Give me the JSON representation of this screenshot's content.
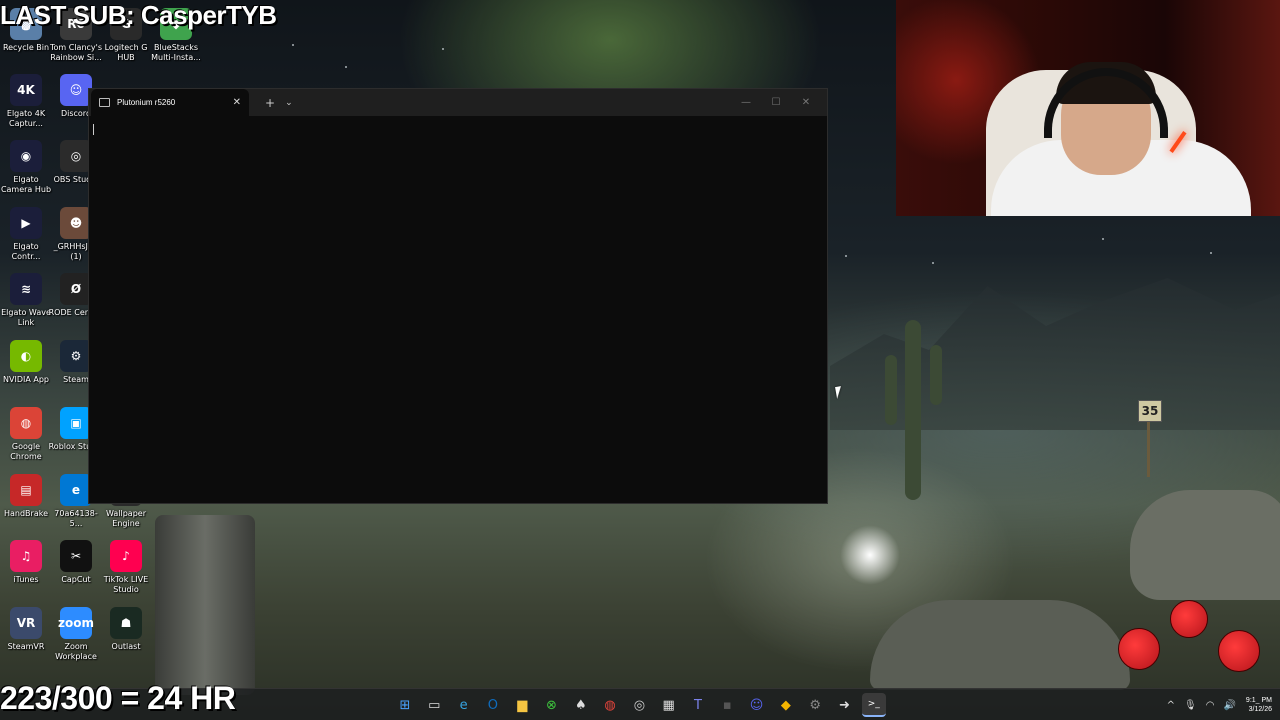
{
  "overlays": {
    "top_text": "LAST SUB: CasperTYB",
    "bottom_text": "223/300 = 24 HR"
  },
  "desktop_icons": [
    {
      "label": "Recycle Bin",
      "icon": "recycle-bin-icon",
      "color": "#5a7fa8",
      "glyph": "🗑"
    },
    {
      "label": "Tom Clancy's Rainbow Si...",
      "icon": "rainbow-six-icon",
      "color": "#3a3a3a",
      "glyph": "R6"
    },
    {
      "label": "Logitech G HUB",
      "icon": "logitech-icon",
      "color": "#2a2a2a",
      "glyph": "G"
    },
    {
      "label": "BlueStacks Multi-Insta...",
      "icon": "bluestacks-icon",
      "color": "#3fa34d",
      "glyph": "◆"
    },
    {
      "label": "Elgato 4K Captur...",
      "icon": "elgato-4k-icon",
      "color": "#1b1e3a",
      "glyph": "4K"
    },
    {
      "label": "Discord",
      "icon": "discord-icon",
      "color": "#5865f2",
      "glyph": "☺"
    },
    {
      "label": "Elgato Camera Hub",
      "icon": "elgato-camera-icon",
      "color": "#1b1e3a",
      "glyph": "◉"
    },
    {
      "label": "OBS Studio",
      "icon": "obs-icon",
      "color": "#2b2b2b",
      "glyph": "◎"
    },
    {
      "label": "Elgato Contr...",
      "icon": "elgato-control-icon",
      "color": "#1b1e3a",
      "glyph": "▶"
    },
    {
      "label": "_GRHHsJSV (1)",
      "icon": "photo-icon",
      "color": "#6b4a3a",
      "glyph": "☻"
    },
    {
      "label": "Elgato Wave Link",
      "icon": "wave-link-icon",
      "color": "#1b1e3a",
      "glyph": "≋"
    },
    {
      "label": "RODE Central",
      "icon": "rode-icon",
      "color": "#222",
      "glyph": "Ø"
    },
    {
      "label": "NVIDIA App",
      "icon": "nvidia-icon",
      "color": "#76b900",
      "glyph": "◐"
    },
    {
      "label": "Steam",
      "icon": "steam-icon",
      "color": "#1b2838",
      "glyph": "⚙"
    },
    {
      "label": "Google Chrome",
      "icon": "chrome-icon",
      "color": "#db4437",
      "glyph": "◍"
    },
    {
      "label": "Roblox Studio",
      "icon": "roblox-icon",
      "color": "#00a2ff",
      "glyph": "▣"
    },
    {
      "label": "HandBrake",
      "icon": "handbrake-icon",
      "color": "#c62828",
      "glyph": "▤"
    },
    {
      "label": "70a64138-5...",
      "icon": "edge-file-icon",
      "color": "#0078d4",
      "glyph": "e"
    },
    {
      "label": "Wallpaper Engine",
      "icon": "wallpaper-engine-icon",
      "color": "#2a2a2a",
      "glyph": "W"
    },
    {
      "label": "iTunes",
      "icon": "itunes-icon",
      "color": "#e91e63",
      "glyph": "♫"
    },
    {
      "label": "CapCut",
      "icon": "capcut-icon",
      "color": "#111",
      "glyph": "✂"
    },
    {
      "label": "TikTok LIVE Studio",
      "icon": "tiktok-icon",
      "color": "#ff0050",
      "glyph": "♪"
    },
    {
      "label": "SteamVR",
      "icon": "steamvr-icon",
      "color": "#3b4a6b",
      "glyph": "VR"
    },
    {
      "label": "Zoom Workplace",
      "icon": "zoom-icon",
      "color": "#2d8cff",
      "glyph": "zoom"
    },
    {
      "label": "Outlast",
      "icon": "outlast-icon",
      "color": "#1a2a22",
      "glyph": "☗"
    }
  ],
  "terminal": {
    "tab_title": "Plutonium r5260",
    "tab_close": "✕",
    "new_tab": "+",
    "dropdown": "⌄",
    "minimize": "—",
    "maximize": "☐",
    "close": "✕"
  },
  "wallpaper": {
    "sign_text": "35"
  },
  "taskbar": {
    "icons": [
      {
        "name": "start-icon",
        "glyph": "⊞",
        "color": "#4aa3ff"
      },
      {
        "name": "task-view-icon",
        "glyph": "▭",
        "color": "#ddd"
      },
      {
        "name": "edge-icon",
        "glyph": "e",
        "color": "#36a3e0"
      },
      {
        "name": "outlook-icon",
        "glyph": "O",
        "color": "#0f6cbd"
      },
      {
        "name": "file-explorer-icon",
        "glyph": "▆",
        "color": "#f5c542"
      },
      {
        "name": "xbox-icon",
        "glyph": "⊗",
        "color": "#3ec43e"
      },
      {
        "name": "alienware-icon",
        "glyph": "♠",
        "color": "#ddd"
      },
      {
        "name": "chrome-icon",
        "glyph": "◍",
        "color": "#e8453c"
      },
      {
        "name": "obs-icon",
        "glyph": "◎",
        "color": "#ccc"
      },
      {
        "name": "store-icon",
        "glyph": "▦",
        "color": "#ddd"
      },
      {
        "name": "teams-icon",
        "glyph": "T",
        "color": "#7b83eb"
      },
      {
        "name": "app-icon",
        "glyph": "▪",
        "color": "#555"
      },
      {
        "name": "discord-icon",
        "glyph": "☺",
        "color": "#5865f2"
      },
      {
        "name": "bluestacks-icon",
        "glyph": "◆",
        "color": "#f4b400"
      },
      {
        "name": "settings-icon",
        "glyph": "⚙",
        "color": "#888"
      },
      {
        "name": "app2-icon",
        "glyph": "➜",
        "color": "#ddd"
      },
      {
        "name": "terminal-icon",
        "glyph": ">_",
        "color": "#fff"
      }
    ],
    "tray": {
      "chevron": "^",
      "mic": "🎙",
      "wifi": "◠",
      "volume": "🔊",
      "time": "9:1_ PM",
      "date": "3/12/26"
    }
  }
}
